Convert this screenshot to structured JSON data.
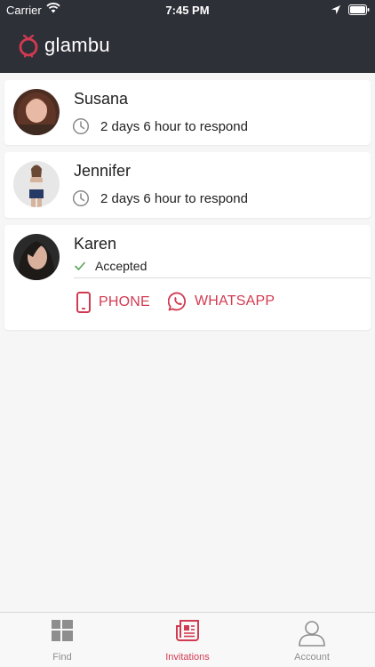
{
  "status_bar": {
    "carrier": "Carrier",
    "time": "7:45 PM"
  },
  "header": {
    "brand": "glambu",
    "accent_color": "#d23a51",
    "bg_color": "#2e3037"
  },
  "invitations": [
    {
      "name": "Susana",
      "status": "2 days 6 hour to respond"
    },
    {
      "name": "Jennifer",
      "status": "2 days 6 hour to respond"
    },
    {
      "name": "Karen",
      "status": "Accepted",
      "actions": {
        "phone": "PHONE",
        "whatsapp": "WHATSAPP"
      }
    }
  ],
  "tabs": [
    {
      "label": "Find",
      "icon": "grid-icon"
    },
    {
      "label": "Invitations",
      "icon": "newspaper-icon",
      "active": true
    },
    {
      "label": "Account",
      "icon": "user-icon"
    }
  ]
}
